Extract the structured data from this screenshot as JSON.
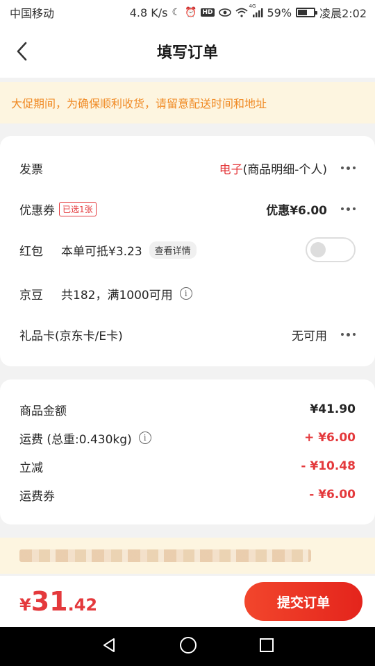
{
  "status_bar": {
    "carrier": "中国移动",
    "speed": "4.8 K/s",
    "hd": "HD",
    "network": "4G",
    "battery": "59%",
    "battery_level": 0.59,
    "time": "凌晨2:02"
  },
  "nav": {
    "title": "填写订单"
  },
  "notice": {
    "text": "大促期间，为确保顺利收货，请留意配送时间和地址"
  },
  "options": {
    "invoice": {
      "label": "发票",
      "type": "电子",
      "detail": "(商品明细-个人)"
    },
    "coupon": {
      "label": "优惠券",
      "tag": "已选1张",
      "value": "优惠¥6.00"
    },
    "redpacket": {
      "label": "红包",
      "desc": "本单可抵¥3.23",
      "link": "查看详情",
      "enabled": false
    },
    "jingdou": {
      "label": "京豆",
      "desc": "共182，满1000可用"
    },
    "giftcard": {
      "label": "礼品卡(京东卡/E卡)",
      "value": "无可用"
    }
  },
  "summary": {
    "items": [
      {
        "label": "商品金额",
        "value": "¥41.90",
        "color": "#262626"
      },
      {
        "label": "运费 (总重:0.430kg)",
        "value": "+ ¥6.00",
        "color": "#e4393c"
      },
      {
        "label": "立减",
        "value": "- ¥10.48",
        "color": "#e4393c"
      },
      {
        "label": "运费券",
        "value": "- ¥6.00",
        "color": "#e4393c"
      }
    ]
  },
  "bottom": {
    "currency": "¥",
    "total_int": "31",
    "total_dec": ".42",
    "submit_label": "提交订单"
  },
  "colors": {
    "accent": "#e4393c",
    "notice_text": "#f08a24",
    "notice_bg": "#fdf5e0"
  }
}
